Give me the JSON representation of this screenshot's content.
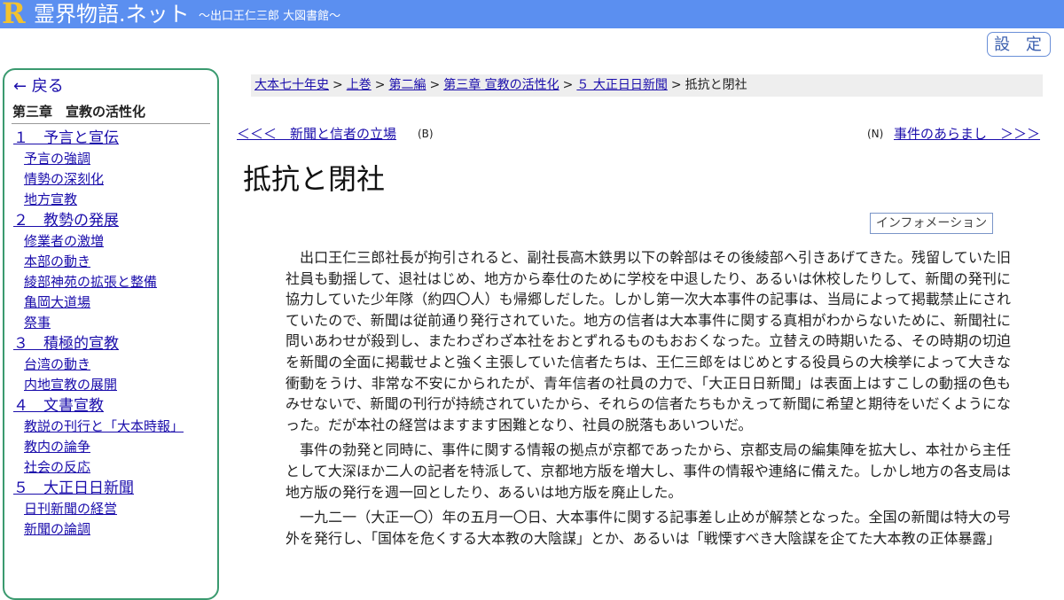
{
  "header": {
    "logo_letter": "R",
    "site_title": "霊界物語.ネット",
    "site_subtitle": "～出口王仁三郎 大図書館～",
    "bg_color": "#5b8ff0",
    "logo_color": "#f2c230"
  },
  "settings_label": "設 定",
  "sidebar": {
    "back_label": "← 戻る",
    "chapter_title": "第三章　宣教の活性化",
    "sections": [
      {
        "label": "１　予言と宣伝",
        "items": [
          "予言の強調",
          "情勢の深刻化",
          "地方宣教"
        ]
      },
      {
        "label": "２　教勢の発展",
        "items": [
          "修業者の激増",
          "本部の動き",
          "綾部神苑の拡張と整備",
          "亀岡大道場",
          "祭事"
        ]
      },
      {
        "label": "３　積極的宣教",
        "items": [
          "台湾の動き",
          "内地宣教の展開"
        ]
      },
      {
        "label": "４　文書宣教",
        "items": [
          "教説の刊行と「大本時報」",
          "教内の論争",
          "社会の反応"
        ]
      },
      {
        "label": "５　大正日日新聞",
        "items": [
          "日刊新聞の経営",
          "新聞の論調"
        ]
      }
    ],
    "border_color": "#3a9a6f"
  },
  "breadcrumb": {
    "links": [
      "大本七十年史",
      "上巻",
      "第二編",
      "第三章 宣教の活性化",
      "５ 大正日日新聞"
    ],
    "separator": ">",
    "current": "抵抗と閉社"
  },
  "nav": {
    "prev_label": "＜＜＜　新聞と信者の立場",
    "prev_key": "(B)",
    "next_key": "(N)",
    "next_label": "事件のあらまし　＞＞＞"
  },
  "page_title": "抵抗と閉社",
  "info_button": "インフォメーション",
  "content": {
    "paragraphs": [
      "出口王仁三郎社長が拘引されると、副社長高木鉄男以下の幹部はその後綾部へ引きあげてきた。残留していた旧社員も動揺して、退社はじめ、地方から奉仕のために学校を中退したり、あるいは休校したりして、新聞の発刊に協力していた少年隊（約四〇人）も帰郷しだした。しかし第一次大本事件の記事は、当局によって掲載禁止にされていたので、新聞は従前通り発行されていた。地方の信者は大本事件に関する真相がわからないために、新聞社に問いあわせが殺到し、またわざわざ本社をおとずれるものもおおくなった。立替えの時期いたる、その時期の切迫を新聞の全面に掲載せよと強く主張していた信者たちは、王仁三郎をはじめとする役員らの大検挙によって大きな衝動をうけ、非常な不安にかられたが、青年信者の社員の力で、「大正日日新聞」は表面上はすこしの動揺の色もみせないで、新聞の刊行が持続されていたから、それらの信者たちもかえって新聞に希望と期待をいだくようになった。だが本社の経営はますます困難となり、社員の脱落もあいついだ。",
      "事件の勃発と同時に、事件に関する情報の拠点が京都であったから、京都支局の編集陣を拡大し、本社から主任として大深ほか二人の記者を特派して、京都地方版を増大し、事件の情報や連絡に備えた。しかし地方の各支局は地方版の発行を週一回としたり、あるいは地方版を廃止した。",
      "一九二一（大正一〇）年の五月一〇日、大本事件に関する記事差し止めが解禁となった。全国の新聞は特大の号外を発行し、「国体を危くする大本教の大陰謀」とか、あるいは「戦慄すべき大陰謀を企てた大本教の正体暴露」"
    ]
  }
}
